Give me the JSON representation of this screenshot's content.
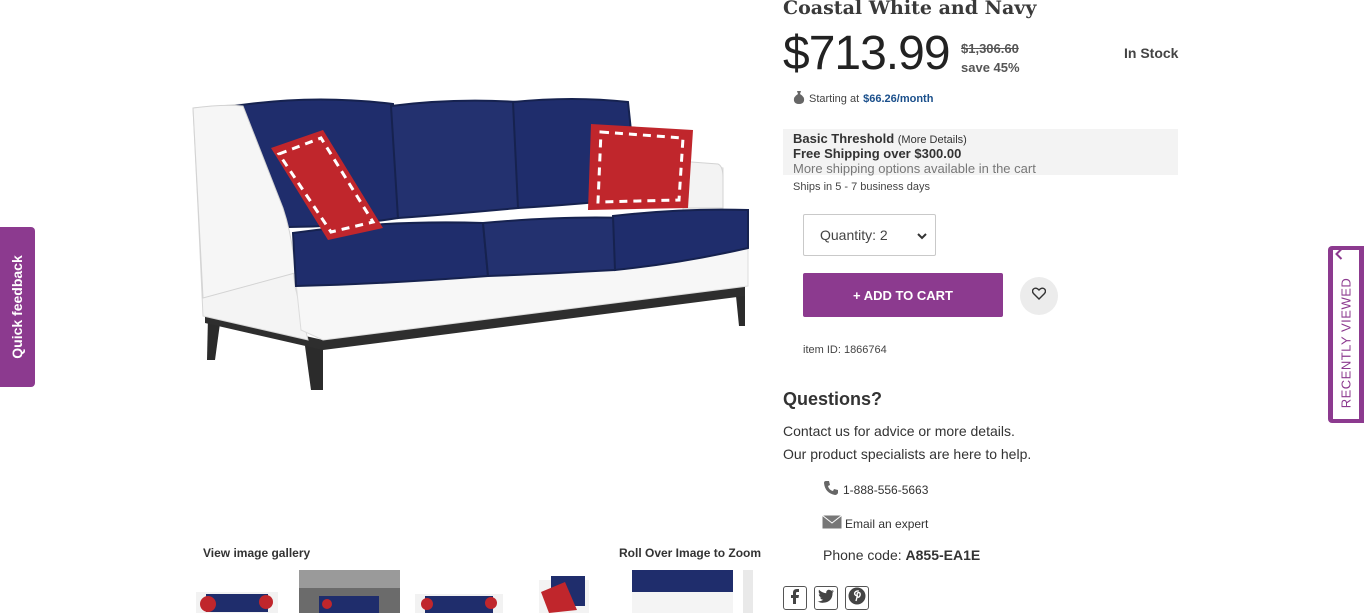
{
  "product": {
    "title": "Coastal White and Navy",
    "price": "$713.99",
    "old_price": "$1,306.60",
    "save": "save 45%",
    "stock": "In Stock",
    "item_id": "item ID: 1866764"
  },
  "finance": {
    "prefix": "Starting at",
    "amount": "$66.26/month"
  },
  "shipping": {
    "threshold_label": "Basic Threshold",
    "more_details": "(More Details)",
    "free_shipping": "Free Shipping over $300.00",
    "more_options": "More shipping options available in the cart",
    "ships_in": "Ships in 5 - 7 business days"
  },
  "cart": {
    "quantity_label": "Quantity: 2",
    "add_to_cart": "+ ADD TO CART"
  },
  "gallery": {
    "view_gallery": "View image gallery",
    "zoom_hint": "Roll Over Image to Zoom"
  },
  "contact": {
    "heading": "Questions?",
    "line1": "Contact us for advice or more details.",
    "line2": "Our product specialists are here to help.",
    "phone": "1-888-556-5663",
    "email": "Email an expert",
    "phone_code_label": "Phone code:",
    "phone_code": "A855-EA1E"
  },
  "tabs": {
    "quick_feedback": "Quick feedback",
    "recently_viewed": "RECENTLY VIEWED"
  },
  "colors": {
    "accent": "#8c3a8f",
    "navy": "#1e2d6b",
    "red": "#c0262c",
    "link": "#1a4f8b"
  },
  "icons": [
    "money-bag-icon",
    "heart-icon",
    "phone-icon",
    "mail-icon",
    "facebook-icon",
    "twitter-icon",
    "pinterest-icon",
    "chevron-up-icon",
    "chevron-down-icon"
  ]
}
